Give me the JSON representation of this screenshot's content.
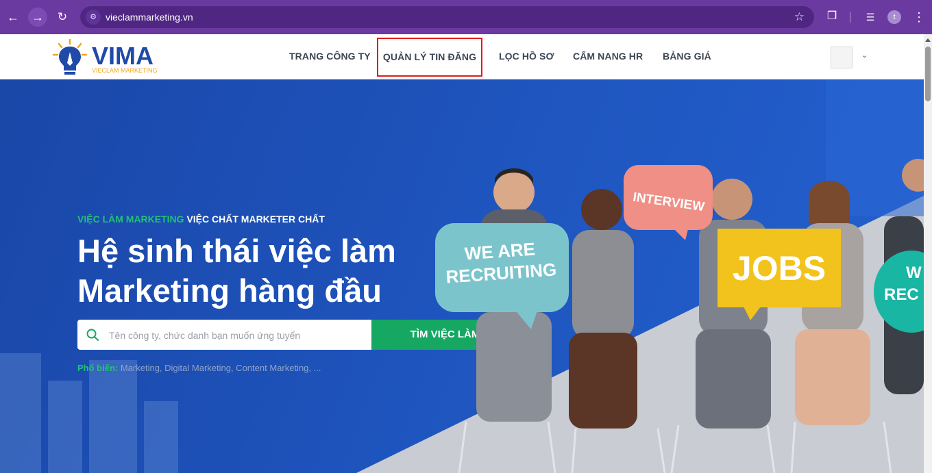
{
  "browser": {
    "url": "vieclammarketing.vn",
    "profile_initial": "t",
    "icons": [
      "back-arrow-icon",
      "forward-arrow-icon",
      "reload-icon",
      "site-info-icon",
      "star-icon",
      "extensions-icon",
      "media-icon",
      "more-icon"
    ]
  },
  "header": {
    "logo": {
      "name": "VIMA",
      "tagline": "VIECLAM MARKETING"
    },
    "nav": [
      "TRANG CÔNG TY",
      "QUẢN LÝ TIN ĐĂNG",
      "LỌC HỒ SƠ",
      "CẨM NANG HR",
      "BẢNG GIÁ"
    ],
    "highlight_color": "#e11b1b"
  },
  "hero": {
    "eyebrow_green": "VIỆC LÀM MARKETING",
    "eyebrow_white": "VIỆC CHẤT MARKETER CHẤT",
    "title_line1": "Hệ sinh thái việc làm",
    "title_line2": "Marketing hàng đầu",
    "search_placeholder": "Tên công ty, chức danh bạn muốn ứng tuyển",
    "search_button": "TÌM VIỆC LÀM",
    "popular_label": "Phổ biến:",
    "popular_tags": "Marketing, Digital Marketing, Content Marketing, ...",
    "signs": {
      "we_are_line1": "WE ARE",
      "we_are_line2": "RECRUITING",
      "interview": "INTERVIEW",
      "jobs": "JOBS",
      "partial_line1": "W",
      "partial_line2": "REC"
    },
    "colors": {
      "primary_blue": "#1f56c0",
      "accent_green": "#16a862",
      "sign_teal": "#7cc4cc",
      "sign_pink": "#ef8f85",
      "sign_yellow": "#f2c31c"
    }
  }
}
